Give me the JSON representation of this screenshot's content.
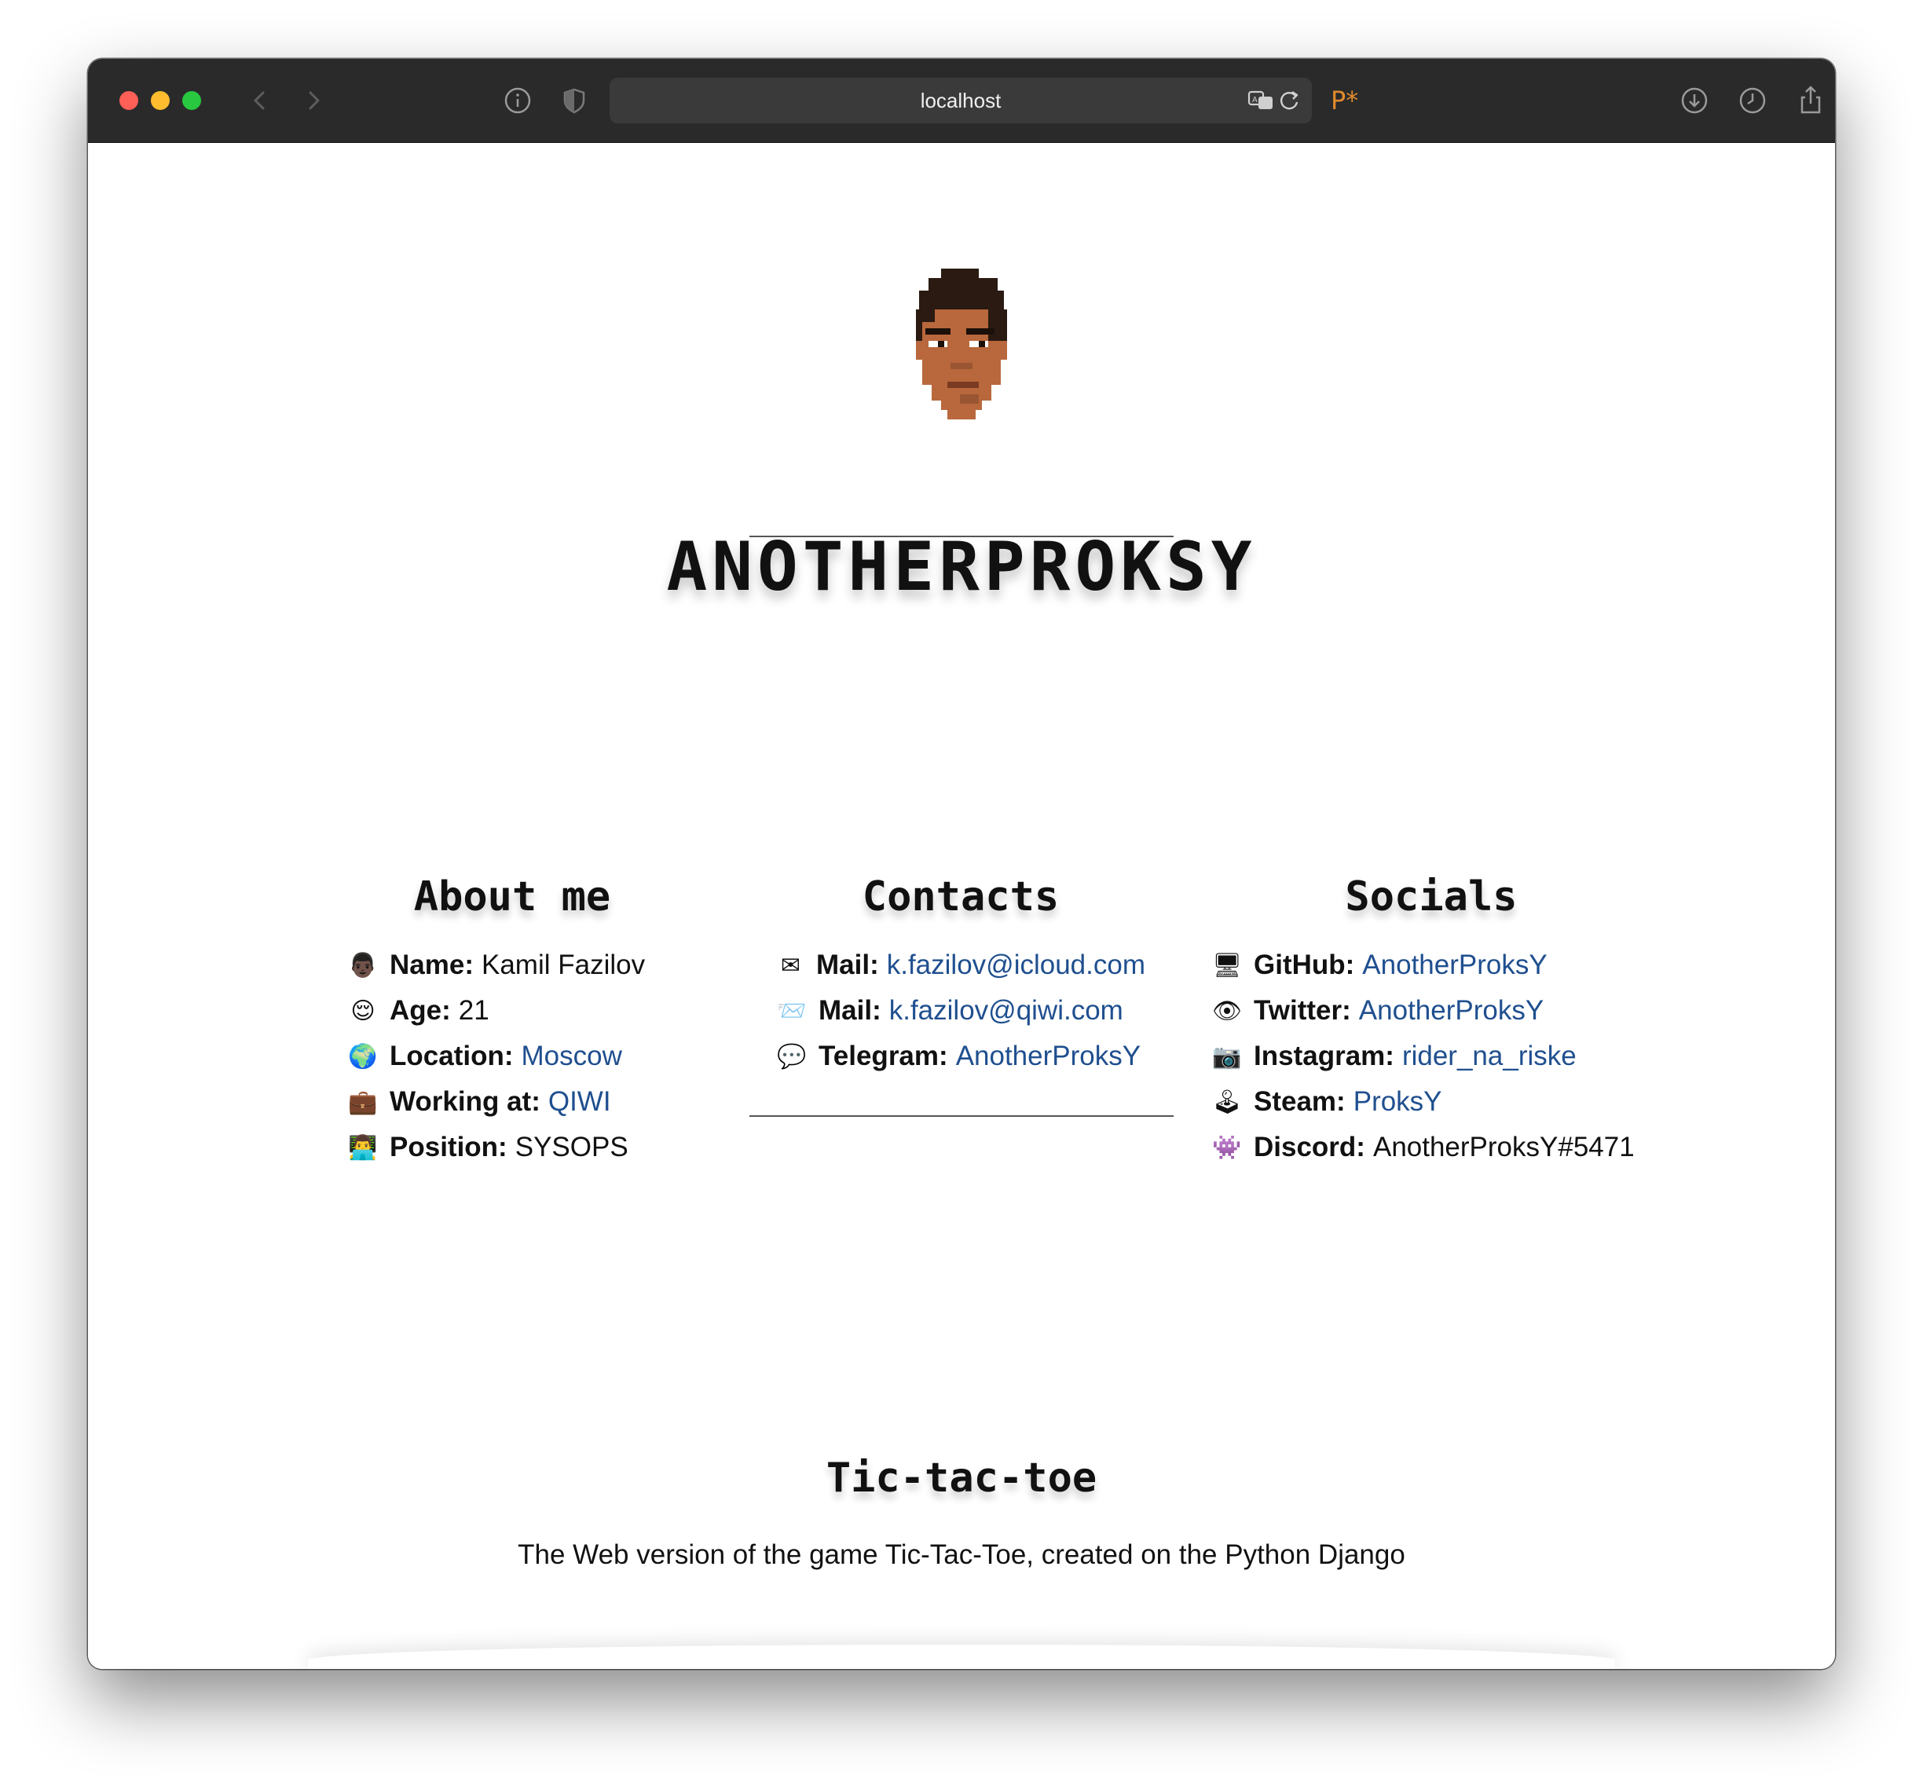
{
  "browser": {
    "address": "localhost",
    "extension_label": "P*"
  },
  "page": {
    "site_title": "ANOTHERPROKSY",
    "about": {
      "heading": "About me",
      "items": [
        {
          "icon": "person-dark-icon",
          "emoji": "👨🏿",
          "label": "Name:",
          "value": "Kamil Fazilov",
          "link": false
        },
        {
          "icon": "face-icon",
          "emoji": "😌",
          "label": "Age:",
          "value": "21",
          "link": false
        },
        {
          "icon": "globe-icon",
          "emoji": "🌍",
          "label": "Location:",
          "value": "Moscow",
          "link": true
        },
        {
          "icon": "briefcase-icon",
          "emoji": "💼",
          "label": "Working at:",
          "value": "QIWI",
          "link": true
        },
        {
          "icon": "technologist-icon",
          "emoji": "👨‍💻",
          "label": "Position:",
          "value": "SYSOPS",
          "link": false
        }
      ]
    },
    "contacts": {
      "heading": "Contacts",
      "items": [
        {
          "icon": "envelope-icon",
          "emoji": "✉",
          "label": "Mail:",
          "value": "k.fazilov@icloud.com",
          "link": true
        },
        {
          "icon": "incoming-envelope-icon",
          "emoji": "📨",
          "label": "Mail:",
          "value": "k.fazilov@qiwi.com",
          "link": true
        },
        {
          "icon": "speech-bubble-icon",
          "emoji": "💬",
          "label": "Telegram:",
          "value": "AnotherProksY",
          "link": true
        }
      ]
    },
    "socials": {
      "heading": "Socials",
      "items": [
        {
          "icon": "desktop-computer-icon",
          "emoji": "🖥",
          "label": "GitHub:",
          "value": "AnotherProksY",
          "link": true
        },
        {
          "icon": "eye-icon",
          "emoji": "👁",
          "label": "Twitter:",
          "value": "AnotherProksY",
          "link": true
        },
        {
          "icon": "camera-icon",
          "emoji": "📷",
          "label": "Instagram:",
          "value": "rider_na_riske",
          "link": true
        },
        {
          "icon": "joystick-icon",
          "emoji": "🕹",
          "label": "Steam:",
          "value": "ProksY",
          "link": true
        },
        {
          "icon": "alien-monster-icon",
          "emoji": "👾",
          "label": "Discord:",
          "value": "AnotherProksY#5471",
          "link": false
        }
      ]
    },
    "project": {
      "title": "Tic-tac-toe",
      "description": "The Web version of the game Tic-Tac-Toe, created on the Python Django"
    }
  },
  "colors": {
    "link": "#1f4f8f",
    "titlebar": "#2a2a2a",
    "text": "#111111"
  }
}
